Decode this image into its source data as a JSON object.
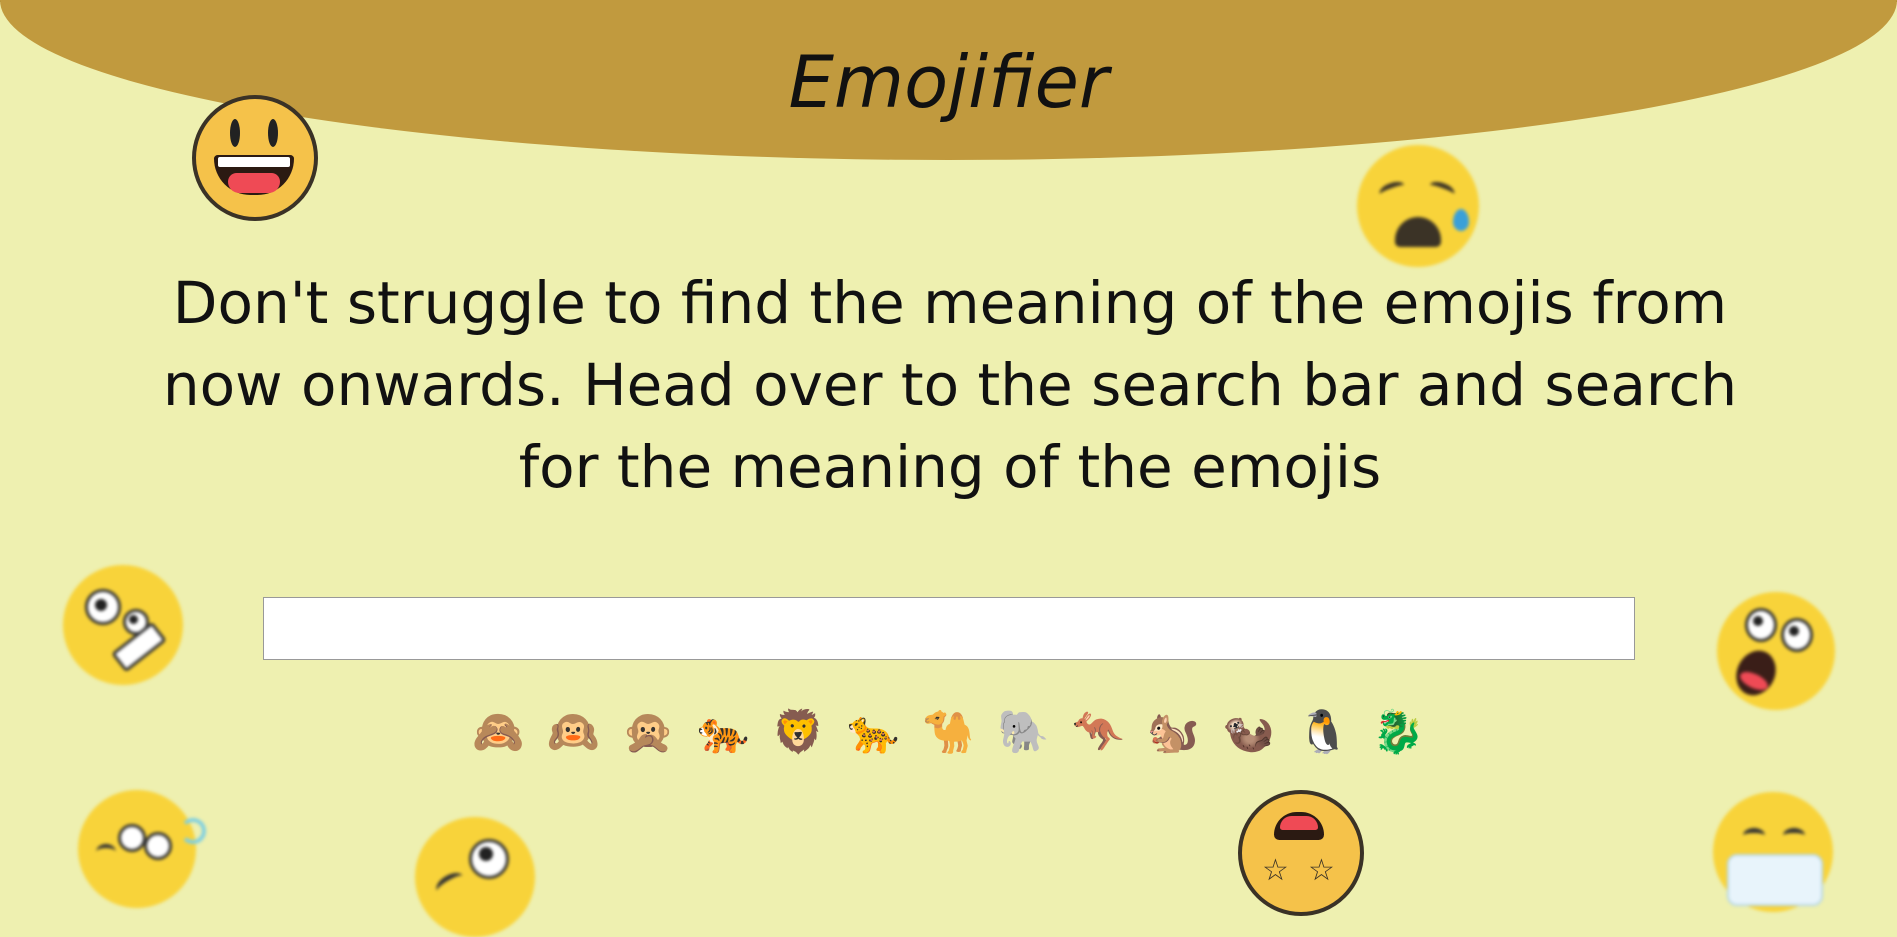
{
  "header": {
    "title": "Emojifier"
  },
  "main": {
    "tagline": "Don't struggle to find the meaning of the emojis from now onwards. Head over to the search bar and search for the meaning of the emojis"
  },
  "search": {
    "value": "",
    "placeholder": ""
  },
  "emojis": [
    "🙈",
    "🙉",
    "🙊",
    "🐅",
    "🦁",
    "🐆",
    "🐪",
    "🐘",
    "🦘",
    "🐿️",
    "🦦",
    "🐧",
    "🐉"
  ],
  "colors": {
    "background": "#eef0b0",
    "header": "#c19a3e",
    "text": "#111111"
  },
  "decorations": [
    "grinning-face-icon",
    "sad-relieved-face-icon",
    "zany-face-icon",
    "screaming-face-icon",
    "dizzy-face-icon",
    "winking-tongue-face-icon",
    "star-struck-face-icon",
    "mask-face-icon"
  ]
}
